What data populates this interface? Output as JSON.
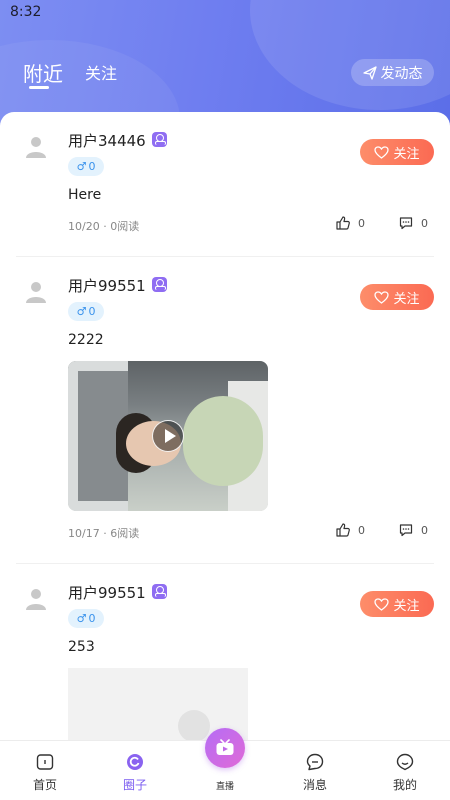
{
  "status_bar": {
    "time": "8:32"
  },
  "header": {
    "tabs": [
      {
        "label": "附近",
        "active": true
      },
      {
        "label": "关注",
        "active": false
      }
    ],
    "post_button_label": "发动态"
  },
  "posts": [
    {
      "username": "用户34446",
      "gender_count": "0",
      "content": "Here",
      "follow_label": "关注",
      "meta": "10/20 · 0阅读",
      "likes": "0",
      "comments": "0",
      "media": "none"
    },
    {
      "username": "用户99551",
      "gender_count": "0",
      "content": "2222",
      "follow_label": "关注",
      "meta": "10/17 · 6阅读",
      "likes": "0",
      "comments": "0",
      "media": "video"
    },
    {
      "username": "用户99551",
      "gender_count": "0",
      "content": "253",
      "follow_label": "关注",
      "media": "image"
    }
  ],
  "tabbar": {
    "items": [
      {
        "label": "首页",
        "icon": "home-icon"
      },
      {
        "label": "圈子",
        "icon": "circle-icon",
        "active": true
      },
      {
        "label": "直播",
        "icon": "live-tv-icon"
      },
      {
        "label": "消息",
        "icon": "message-icon"
      },
      {
        "label": "我的",
        "icon": "profile-icon"
      }
    ]
  },
  "colors": {
    "header_gradient_start": "#7d8ef2",
    "header_gradient_end": "#5b6ee8",
    "follow_button": "#fb6a53",
    "active_tab": "#7b5cf0",
    "gender_badge_bg": "#e3f2fd",
    "gender_badge_text": "#3b93ec",
    "vip_badge": "#8f6df2"
  }
}
